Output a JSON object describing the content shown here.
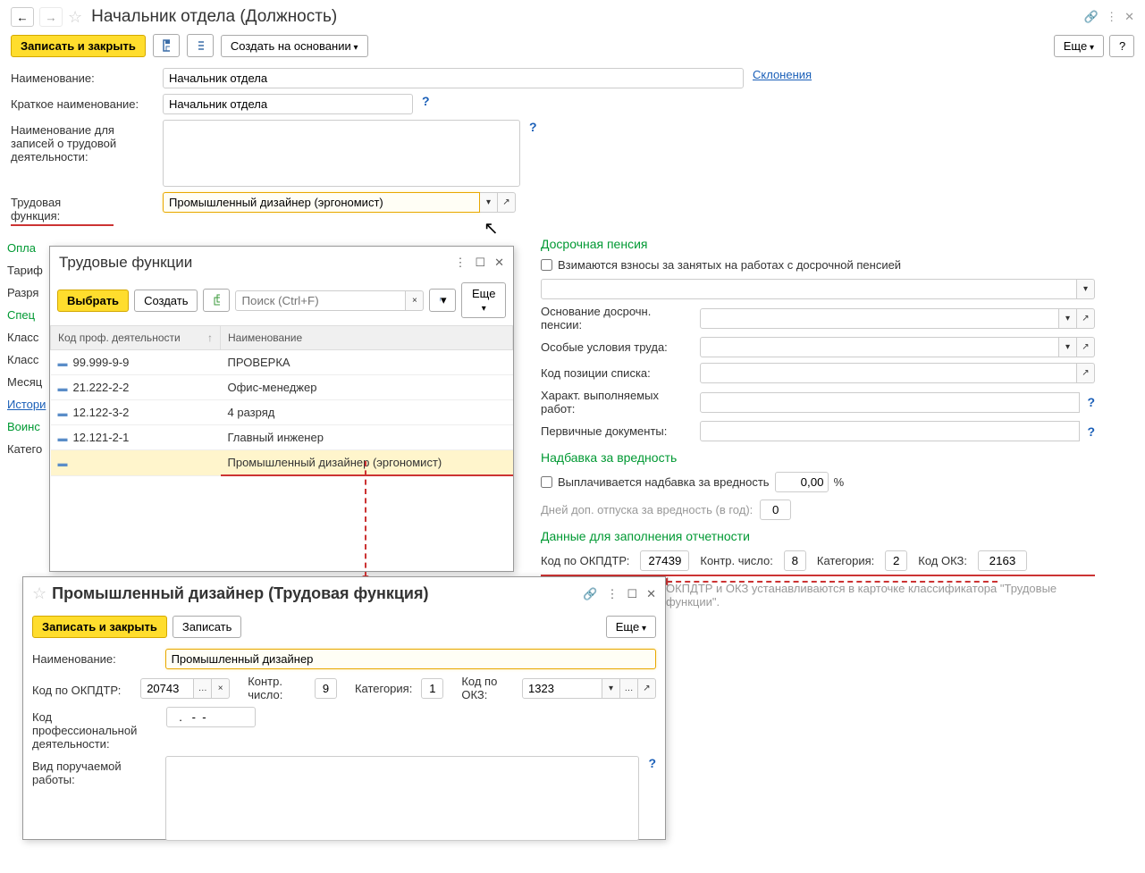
{
  "main": {
    "title": "Начальник отдела (Должность)",
    "toolbar": {
      "save_close": "Записать и закрыть",
      "create_based": "Создать на основании",
      "more": "Еще"
    },
    "fields": {
      "name_label": "Наименование:",
      "name_value": "Начальник отдела",
      "declensions_link": "Склонения",
      "short_name_label": "Краткое наименование:",
      "short_name_value": "Начальник отдела",
      "activity_name_label": "Наименование для записей о трудовой деятельности:",
      "labor_function_label": "Трудовая функция:",
      "labor_function_value": "Промышленный дизайнер (эргономист)"
    }
  },
  "left_labels": {
    "l1": "Опла",
    "l2": "Тариф",
    "l3": "Разря",
    "l4": "Спец",
    "l5": "Класс",
    "l6": "Класс",
    "l7": "Месяц",
    "l8": "Истори",
    "l9": "Воинс",
    "l10": "Катего"
  },
  "right": {
    "pension_title": "Досрочная пенсия",
    "pension_checkbox": "Взимаются взносы за занятых на работах с досрочной пенсией",
    "pension_basis": "Основание досрочн. пенсии:",
    "special_conditions": "Особые условия труда:",
    "list_position": "Код позиции списка:",
    "work_character": "Характ. выполняемых работ:",
    "primary_docs": "Первичные документы:",
    "hazard_title": "Надбавка за вредность",
    "hazard_checkbox": "Выплачивается надбавка за вредность",
    "hazard_value": "0,00",
    "hazard_pct": "%",
    "extra_days_label": "Дней доп. отпуска за вредность (в год):",
    "extra_days_value": "0",
    "report_title": "Данные для заполнения отчетности",
    "okpdtr_label": "Код по ОКПДТР:",
    "okpdtr_value": "27439",
    "control_label": "Контр. число:",
    "control_value": "8",
    "category_label": "Категория:",
    "category_value": "2",
    "okz_label": "Код ОКЗ:",
    "okz_value": "2163",
    "hint": "ОКПДТР и ОКЗ устанавливаются в карточке классификатора \"Трудовые функции\"."
  },
  "popup1": {
    "title": "Трудовые функции",
    "select_btn": "Выбрать",
    "create_btn": "Создать",
    "search_placeholder": "Поиск (Ctrl+F)",
    "more": "Еще",
    "col1": "Код проф. деятельности",
    "col2": "Наименование",
    "rows": [
      {
        "code": "99.999-9-9",
        "name": "ПРОВЕРКА"
      },
      {
        "code": "21.222-2-2",
        "name": "Офис-менеджер"
      },
      {
        "code": "12.122-3-2",
        "name": "4 разряд"
      },
      {
        "code": "12.121-2-1",
        "name": "Главный инженер"
      },
      {
        "code": "",
        "name": "Промышленный дизайнер (эргономист)"
      }
    ]
  },
  "popup2": {
    "title": "Промышленный дизайнер (Трудовая функция)",
    "save_close": "Записать и закрыть",
    "save": "Записать",
    "more": "Еще",
    "name_label": "Наименование:",
    "name_value": "Промышленный дизайнер",
    "okpdtr_label": "Код по ОКПДТР:",
    "okpdtr_value": "20743",
    "control_label": "Контр. число:",
    "control_value": "9",
    "category_label": "Категория:",
    "category_value": "1",
    "okz_label": "Код по ОКЗ:",
    "okz_value": "1323",
    "prof_code_label": "Код профессиональной деятельности:",
    "prof_code_value": "  .   -  -",
    "work_type_label": "Вид поручаемой работы:"
  }
}
